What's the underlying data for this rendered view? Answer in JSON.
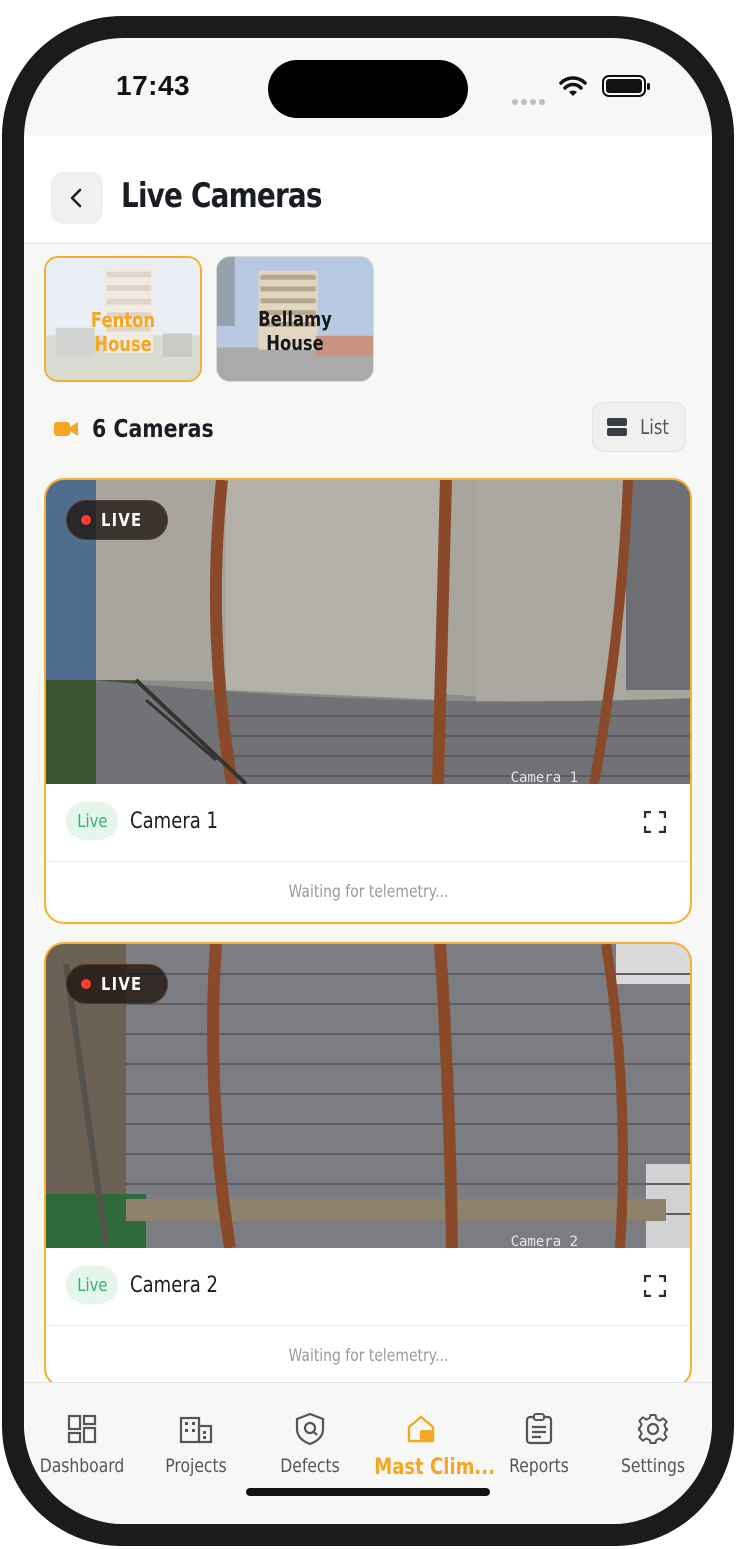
{
  "status_bar": {
    "time": "17:43"
  },
  "header": {
    "title": "Live Cameras",
    "back_icon": "chevron-left-icon"
  },
  "properties": [
    {
      "name": "Fenton House",
      "selected": true
    },
    {
      "name": "Bellamy House",
      "selected": false
    }
  ],
  "cameras_bar": {
    "count_label": "6 Cameras",
    "view_toggle_label": "List"
  },
  "cameras": [
    {
      "status_badge": "LIVE",
      "badge": "Live",
      "name": "Camera 1",
      "overlay": "Camera 1",
      "telemetry": "Waiting for telemetry..."
    },
    {
      "status_badge": "LIVE",
      "badge": "Live",
      "name": "Camera 2",
      "overlay": "Camera 2",
      "telemetry": "Waiting for telemetry..."
    }
  ],
  "tabbar": {
    "items": [
      {
        "label": "Dashboard",
        "icon": "dashboard-icon"
      },
      {
        "label": "Projects",
        "icon": "building-icon"
      },
      {
        "label": "Defects",
        "icon": "shield-icon"
      },
      {
        "label": "Mast Clim...",
        "icon": "mast-climber-icon",
        "active": true
      },
      {
        "label": "Reports",
        "icon": "clipboard-icon"
      },
      {
        "label": "Settings",
        "icon": "gear-icon"
      }
    ]
  },
  "colors": {
    "accent": "#f5a623",
    "live_green": "#2fb36b",
    "live_dot": "#ff3b30"
  }
}
